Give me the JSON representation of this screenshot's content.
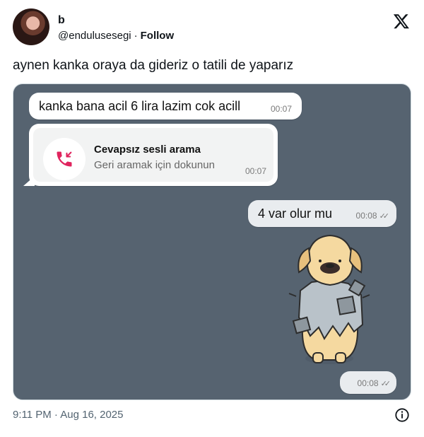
{
  "user": {
    "name": "b",
    "handle": "@endulusesegi",
    "separator": "·",
    "follow_label": "Follow"
  },
  "tweet": {
    "text": "aynen kanka oraya da gideriz o tatili de yaparız",
    "timestamp": "9:11 PM · Aug 16, 2025"
  },
  "chat": {
    "msg1": {
      "text": "kanka bana acil 6 lira lazim cok acill",
      "time": "00:07"
    },
    "missed_call": {
      "title": "Cevapsız sesli arama",
      "subtitle": "Geri aramak için dokunun",
      "time": "00:07"
    },
    "msg2": {
      "text": "4 var olur mu",
      "time": "00:08"
    },
    "sticker_time": "00:08"
  },
  "icons": {
    "logo": "x-logo-icon",
    "call": "missed-call-icon",
    "info": "info-icon",
    "read": "double-check-icon"
  },
  "colors": {
    "chat_bg": "#566370",
    "missed_call": "#e0245e",
    "muted": "#536471"
  }
}
